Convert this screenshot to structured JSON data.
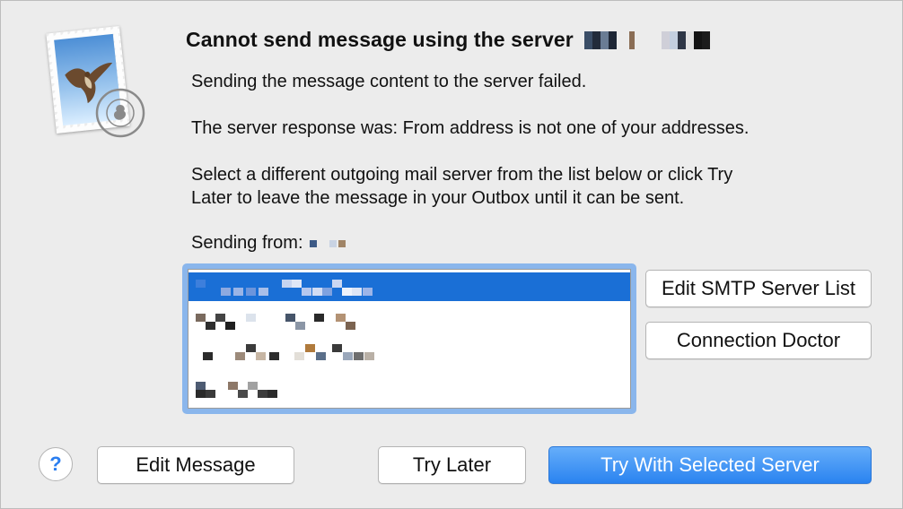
{
  "dialog": {
    "title": "Cannot send message using the server",
    "line1": "Sending the message content to the server failed.",
    "line2": "The server response was: From address is not one of your addresses.",
    "line3a": "Select a different outgoing mail server from the list below or click Try",
    "line3b": "Later to leave the message in your Outbox until it can be sent.",
    "sending_from_label": "Sending from:"
  },
  "icons": {
    "app": "mail-stamp-icon",
    "help": "help-icon"
  },
  "buttons": {
    "edit_smtp": "Edit SMTP Server List",
    "connection_doctor": "Connection Doctor",
    "help": "?",
    "edit_message": "Edit Message",
    "try_later": "Try Later",
    "try_selected": "Try With Selected Server"
  },
  "colors": {
    "accent": "#1a6fd6",
    "primary_button": "#2a83f0",
    "focus_ring": "#8ab6ec"
  }
}
